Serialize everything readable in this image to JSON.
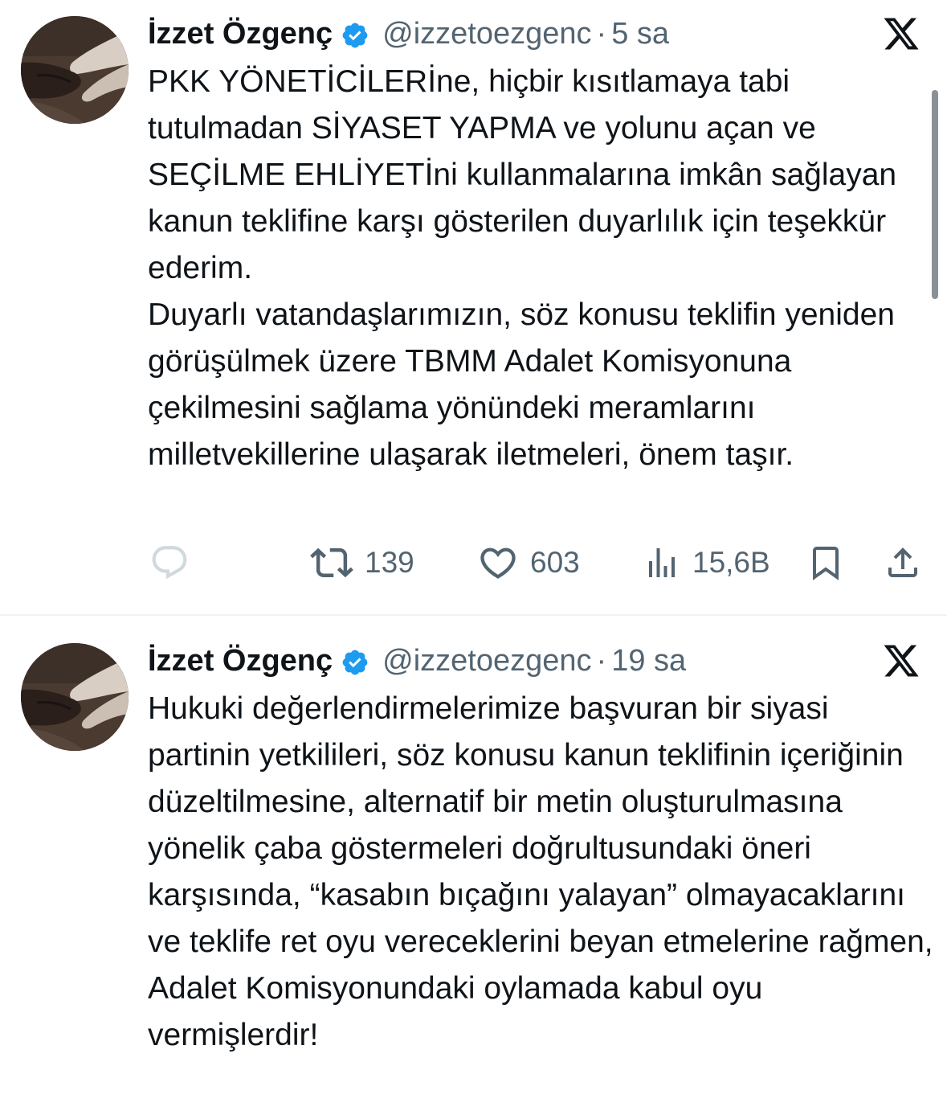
{
  "tweets": [
    {
      "author": {
        "name": "İzzet Özgenç",
        "handle": "@izzetoezgenc",
        "verified": true
      },
      "separator": "·",
      "time": "5 sa",
      "text": "PKK YÖNETİCİLERİne, hiçbir kısıtlamaya tabi tutulmadan SİYASET YAPMA ve yolunu açan ve SEÇİLME EHLİYETİni kullanmalarına imkân sağlayan kanun teklifine karşı gösterilen duyarlılık için teşekkür ederim.\nDuyarlı vatandaşlarımızın, söz konusu teklifin yeniden görüşülmek üzere TBMM Adalet Komisyonuna çekilmesini sağlama yönündeki meramlarını milletvekillerine ulaşarak iletmeleri, önem taşır.",
      "stats": {
        "retweets": "139",
        "likes": "603",
        "views": "15,6B"
      }
    },
    {
      "author": {
        "name": "İzzet Özgenç",
        "handle": "@izzetoezgenc",
        "verified": true
      },
      "separator": "·",
      "time": "19 sa",
      "text": "Hukuki değerlendirmelerimize başvuran bir siyasi partinin yetkilileri, söz konusu kanun teklifinin içeriğinin düzeltilmesine, alternatif bir metin oluşturulmasına yönelik çaba göstermeleri doğrultusundaki öneri karşısında, “kasabın bıçağını yalayan” olmayacaklarını ve teklife ret oyu vereceklerini beyan etmelerine rağmen, Adalet Komisyonundaki oylamada kabul oyu vermişlerdir!"
    }
  ],
  "icons": {
    "verified_badge": "verified-badge-icon",
    "platform_logo": "x-logo-icon",
    "reply": "reply-icon",
    "retweet": "retweet-icon",
    "like": "heart-icon",
    "views": "views-chart-icon",
    "bookmark": "bookmark-icon",
    "share": "share-icon"
  },
  "colors": {
    "text": "#0f1419",
    "secondary": "#536471",
    "verified": "#1d9bf0",
    "divider": "#eff3f4",
    "reply_icon": "#cfd9de"
  }
}
